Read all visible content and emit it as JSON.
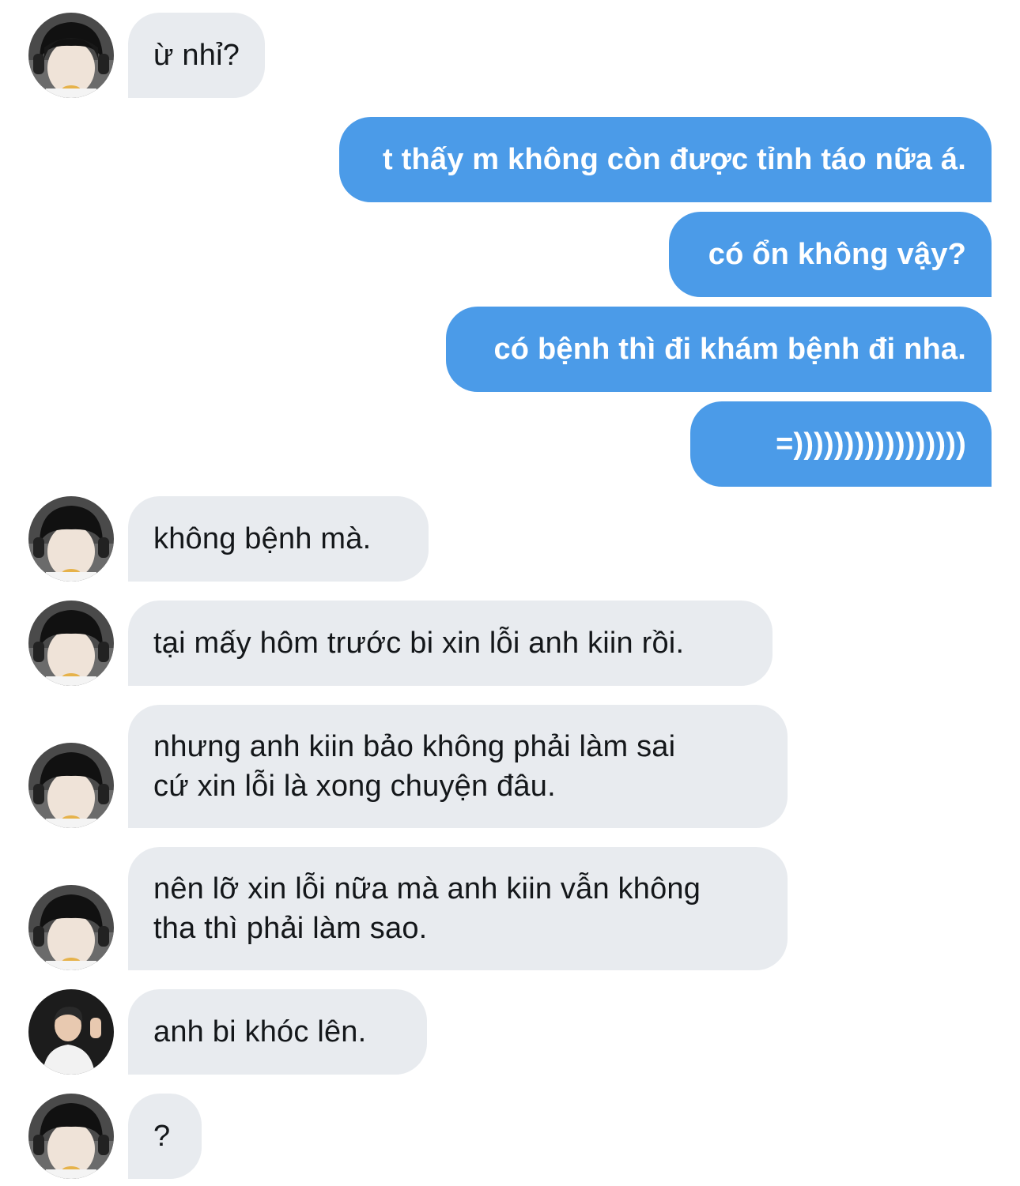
{
  "messages": [
    {
      "from": "incoming",
      "avatar": "boy-headphones",
      "lines": [
        "ừ nhỉ?"
      ]
    },
    {
      "from": "outgoing",
      "lines": [
        "t thấy m không còn được tỉnh táo nữa á."
      ]
    },
    {
      "from": "outgoing",
      "lines": [
        "có ổn không vậy?"
      ]
    },
    {
      "from": "outgoing",
      "lines": [
        "có bệnh thì đi khám bệnh đi nha."
      ]
    },
    {
      "from": "outgoing",
      "lines": [
        "=)))))))))))))))))"
      ]
    },
    {
      "from": "incoming",
      "avatar": "boy-headphones",
      "lines": [
        "không bệnh mà."
      ]
    },
    {
      "from": "incoming",
      "avatar": "boy-headphones",
      "lines": [
        "tại mấy hôm trước bi xin lỗi anh kiin rồi."
      ]
    },
    {
      "from": "incoming",
      "avatar": "boy-headphones",
      "lines": [
        "nhưng anh kiin bảo không phải làm sai",
        "cứ xin lỗi là xong chuyện đâu."
      ]
    },
    {
      "from": "incoming",
      "avatar": "boy-headphones",
      "lines": [
        "nên lỡ xin lỗi nữa mà anh kiin vẫn không",
        "tha thì phải làm sao."
      ]
    },
    {
      "from": "incoming",
      "avatar": "man-white-shirt",
      "lines": [
        "anh bi khóc lên."
      ]
    },
    {
      "from": "incoming",
      "avatar": "boy-headphones",
      "lines": [
        "?"
      ]
    }
  ],
  "colors": {
    "outgoing_bubble": "#4b9be8",
    "incoming_bubble": "#e8ebef",
    "incoming_text": "#14171a",
    "outgoing_text": "#ffffff",
    "background": "#ffffff"
  }
}
